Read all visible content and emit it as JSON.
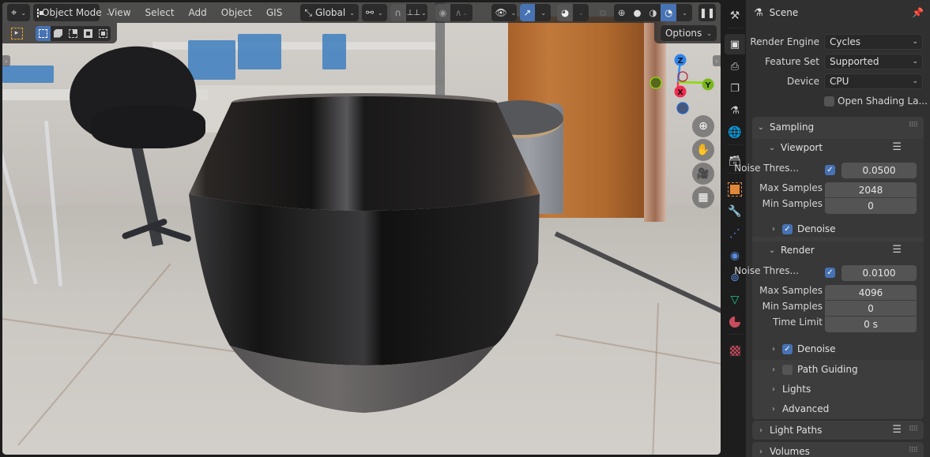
{
  "viewport": {
    "header": {
      "editor_type_icon": "3d-viewport-icon",
      "mode": "Object Mode",
      "menus": [
        "View",
        "Select",
        "Add",
        "Object",
        "GIS"
      ],
      "transform_orientation": "Global",
      "pivot_icon": "pivot-point-icon",
      "snap_icon": "snap-magnet-icon",
      "snap_target_icon": "snap-increment-icon",
      "proportional_icon": "proportional-edit-icon",
      "falloff_icon": "falloff-curve-icon",
      "visibility_icon": "visibility-eye-icon",
      "gizmo_icon": "gizmo-toggle-icon",
      "overlay_icon": "overlays-icon",
      "xray_icon": "xray-toggle-icon",
      "shading_modes": [
        "Wireframe",
        "Solid",
        "Material Preview",
        "Rendered"
      ],
      "active_shading": "Rendered",
      "pause_icon": "pause-render-icon"
    },
    "tool_header": {
      "active_tool_icon": "select-box-tool-icon",
      "selection_modes": [
        "Set new selection",
        "Extend selection",
        "Subtract selection",
        "Invert selection",
        "Intersect selection"
      ],
      "active_selection_mode": 0,
      "options_label": "Options"
    },
    "gizmo": {
      "axes": {
        "z": "Z",
        "x": "X",
        "y": "Y"
      },
      "colors": {
        "x": "#ff3352",
        "y": "#8bdc00",
        "z": "#2890ff"
      }
    },
    "nav_buttons": [
      "zoom-icon",
      "pan-hand-icon",
      "camera-view-icon",
      "ortho-grid-icon"
    ]
  },
  "properties": {
    "tabs": [
      {
        "name": "tool",
        "icon": "tool-icon"
      },
      {
        "name": "render",
        "icon": "render-icon",
        "active": true
      },
      {
        "name": "output",
        "icon": "output-icon"
      },
      {
        "name": "view-layer",
        "icon": "view-layer-icon"
      },
      {
        "name": "scene",
        "icon": "scene-icon"
      },
      {
        "name": "world",
        "icon": "world-icon"
      },
      {
        "name": "collection",
        "icon": "collection-icon"
      },
      {
        "name": "object",
        "icon": "object-icon"
      },
      {
        "name": "modifiers",
        "icon": "modifier-wrench-icon"
      },
      {
        "name": "particles",
        "icon": "particles-icon"
      },
      {
        "name": "physics",
        "icon": "physics-icon"
      },
      {
        "name": "constraints",
        "icon": "constraints-icon"
      },
      {
        "name": "data",
        "icon": "mesh-data-icon"
      },
      {
        "name": "material",
        "icon": "material-icon"
      },
      {
        "name": "texture",
        "icon": "texture-icon"
      }
    ],
    "header_title": "Scene",
    "render_engine": {
      "label": "Render Engine",
      "value": "Cycles"
    },
    "feature_set": {
      "label": "Feature Set",
      "value": "Supported"
    },
    "device": {
      "label": "Device",
      "value": "CPU"
    },
    "osl": {
      "label": "Open Shading La...",
      "checked": false
    },
    "sampling": {
      "title": "Sampling",
      "viewport": {
        "title": "Viewport",
        "noise_threshold": {
          "label": "Noise Thres...",
          "enabled": true,
          "value": "0.0500"
        },
        "max_samples": {
          "label": "Max Samples",
          "value": "2048"
        },
        "min_samples": {
          "label": "Min Samples",
          "value": "0"
        },
        "denoise": {
          "label": "Denoise",
          "checked": true
        }
      },
      "render": {
        "title": "Render",
        "noise_threshold": {
          "label": "Noise Thres...",
          "enabled": true,
          "value": "0.0100"
        },
        "max_samples": {
          "label": "Max Samples",
          "value": "4096"
        },
        "min_samples": {
          "label": "Min Samples",
          "value": "0"
        },
        "time_limit": {
          "label": "Time Limit",
          "value": "0 s"
        },
        "denoise": {
          "label": "Denoise",
          "checked": true
        }
      },
      "path_guiding": {
        "label": "Path Guiding",
        "checked": false
      },
      "lights": {
        "label": "Lights"
      },
      "advanced": {
        "label": "Advanced"
      }
    },
    "light_paths": {
      "title": "Light Paths"
    },
    "volumes": {
      "title": "Volumes"
    }
  }
}
